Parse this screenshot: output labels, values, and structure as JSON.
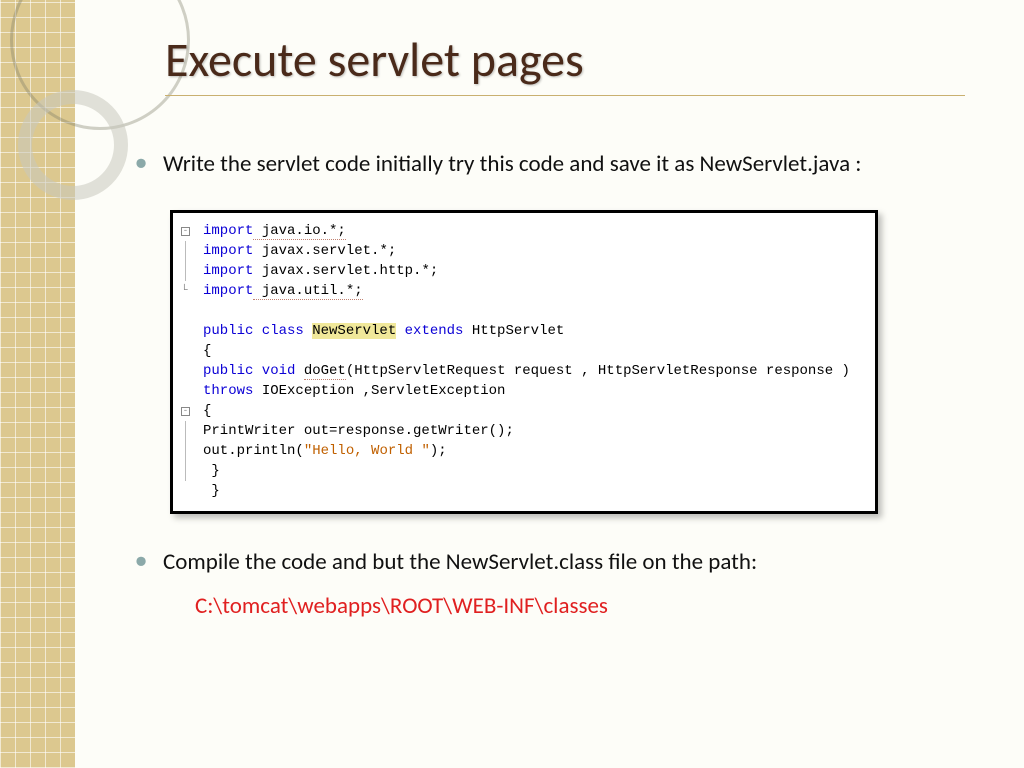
{
  "slide": {
    "title": "Execute servlet pages",
    "bullet1": "Write the servlet code initially try this code and save it as NewServlet.java :",
    "bullet2": "Compile the code and but the NewServlet.class file on the path:",
    "path": "C:\\tomcat\\webapps\\ROOT\\WEB-INF\\classes"
  },
  "code": {
    "l1_kw": "import",
    "l1_rest": " java.io.*;",
    "l2_kw": "import",
    "l2_rest": " javax.servlet.*;",
    "l3_kw": "import",
    "l3_rest": " javax.servlet.http.*;",
    "l4_kw": "import",
    "l4_rest": " java.util.*;",
    "l5a": "public class ",
    "l5_hl": "NewServlet",
    "l5b": " extends",
    "l5c": " HttpServlet",
    "l6": "{",
    "l7a": "public void ",
    "l7_m": "doGet",
    "l7b": "(HttpServletRequest request , HttpServletResponse response )",
    "l8a": "throws",
    "l8b": " IOException ,ServletException",
    "l9": "{",
    "l10": "PrintWriter out=response.getWriter();",
    "l11a": "out.println(",
    "l11_str": "\"Hello, World \"",
    "l11b": ");",
    "l12": " }",
    "l13": " }"
  }
}
